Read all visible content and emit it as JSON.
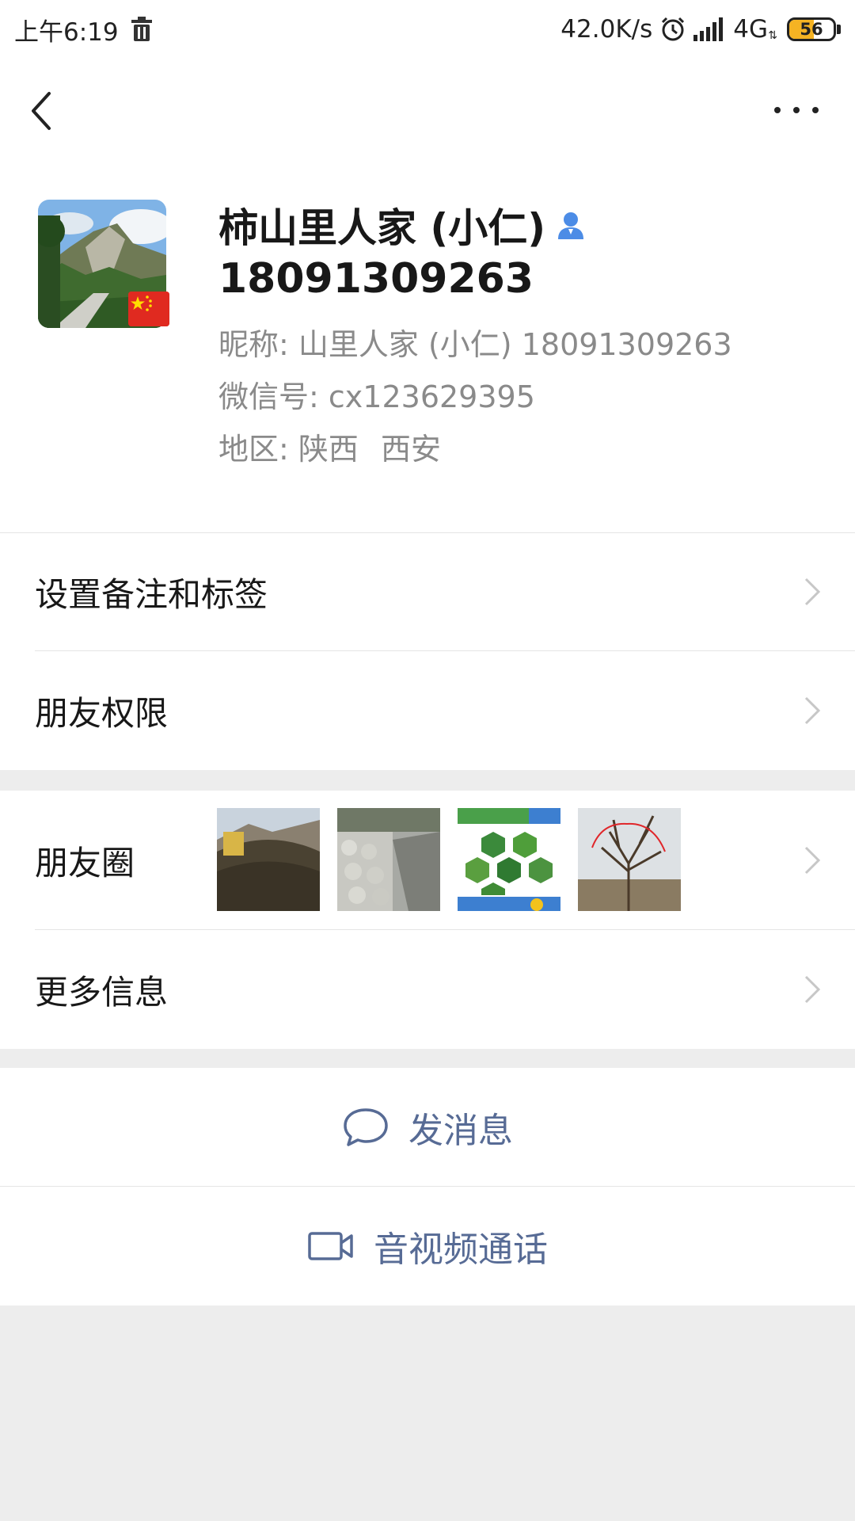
{
  "status_bar": {
    "time": "上午6:19",
    "net_speed": "42.0K/s",
    "network": "4G",
    "battery": "56",
    "battery_level": 0.56
  },
  "profile": {
    "name": "柿山里人家 (小仁)",
    "phone": "18091309263",
    "nickname_label": "昵称:",
    "nickname": "山里人家 (小仁) 18091309263",
    "wechat_label": "微信号:",
    "wechat_id": "cx123629395",
    "region_label": "地区:",
    "region_province": "陕西",
    "region_city": "西安"
  },
  "menu": {
    "remark": "设置备注和标签",
    "permissions": "朋友权限",
    "moments": "朋友圈",
    "more_info": "更多信息"
  },
  "actions": {
    "message": "发消息",
    "call": "音视频通话"
  },
  "colors": {
    "link": "#576b95",
    "background": "#ededed",
    "contact_icon": "#4c8ce6"
  },
  "icons": [
    "back-icon",
    "more-icon",
    "trash-icon",
    "alarm-icon",
    "signal-icon",
    "contact-icon",
    "chevron-right-icon",
    "chat-bubble-icon",
    "video-camera-icon"
  ]
}
